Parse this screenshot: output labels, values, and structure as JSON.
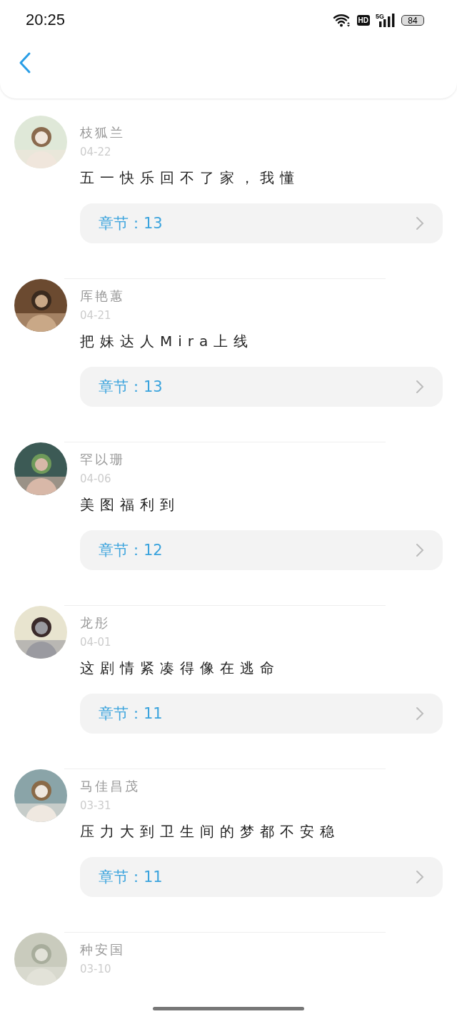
{
  "status_bar": {
    "time": "20:25",
    "hd": "HD",
    "network": "5G",
    "battery": "84"
  },
  "comments": [
    {
      "name": "枝狐兰",
      "date": "04-22",
      "text": "五一快乐回不了家，我懂",
      "chapter": "章节：13"
    },
    {
      "name": "厍艳蕙",
      "date": "04-21",
      "text": "把妹达人Mira上线",
      "chapter": "章节：13"
    },
    {
      "name": "罕以珊",
      "date": "04-06",
      "text": "美图福利到",
      "chapter": "章节：12"
    },
    {
      "name": "龙彤",
      "date": "04-01",
      "text": "这剧情紧凑得像在逃命",
      "chapter": "章节：11"
    },
    {
      "name": "马佳昌茂",
      "date": "03-31",
      "text": "压力大到卫生间的梦都不安稳",
      "chapter": "章节：11"
    },
    {
      "name": "种安国",
      "date": "03-10"
    }
  ]
}
